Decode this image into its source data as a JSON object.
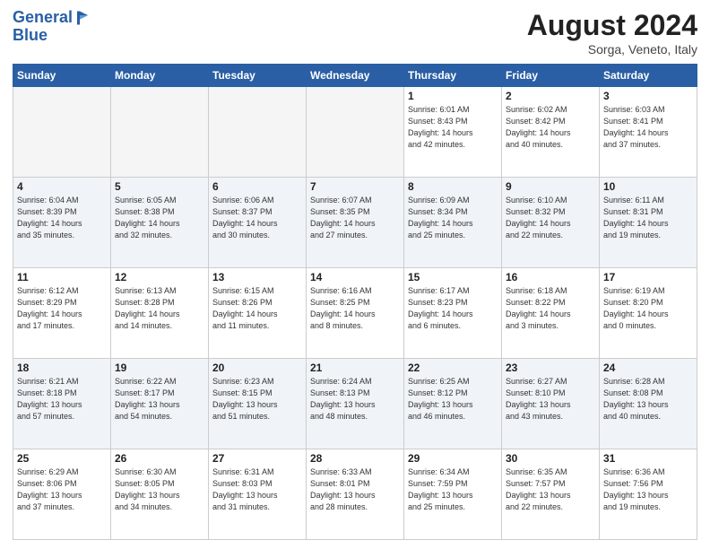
{
  "header": {
    "logo_line1": "General",
    "logo_line2": "Blue",
    "month": "August 2024",
    "location": "Sorga, Veneto, Italy"
  },
  "weekdays": [
    "Sunday",
    "Monday",
    "Tuesday",
    "Wednesday",
    "Thursday",
    "Friday",
    "Saturday"
  ],
  "weeks": [
    [
      {
        "day": "",
        "info": ""
      },
      {
        "day": "",
        "info": ""
      },
      {
        "day": "",
        "info": ""
      },
      {
        "day": "",
        "info": ""
      },
      {
        "day": "1",
        "info": "Sunrise: 6:01 AM\nSunset: 8:43 PM\nDaylight: 14 hours\nand 42 minutes."
      },
      {
        "day": "2",
        "info": "Sunrise: 6:02 AM\nSunset: 8:42 PM\nDaylight: 14 hours\nand 40 minutes."
      },
      {
        "day": "3",
        "info": "Sunrise: 6:03 AM\nSunset: 8:41 PM\nDaylight: 14 hours\nand 37 minutes."
      }
    ],
    [
      {
        "day": "4",
        "info": "Sunrise: 6:04 AM\nSunset: 8:39 PM\nDaylight: 14 hours\nand 35 minutes."
      },
      {
        "day": "5",
        "info": "Sunrise: 6:05 AM\nSunset: 8:38 PM\nDaylight: 14 hours\nand 32 minutes."
      },
      {
        "day": "6",
        "info": "Sunrise: 6:06 AM\nSunset: 8:37 PM\nDaylight: 14 hours\nand 30 minutes."
      },
      {
        "day": "7",
        "info": "Sunrise: 6:07 AM\nSunset: 8:35 PM\nDaylight: 14 hours\nand 27 minutes."
      },
      {
        "day": "8",
        "info": "Sunrise: 6:09 AM\nSunset: 8:34 PM\nDaylight: 14 hours\nand 25 minutes."
      },
      {
        "day": "9",
        "info": "Sunrise: 6:10 AM\nSunset: 8:32 PM\nDaylight: 14 hours\nand 22 minutes."
      },
      {
        "day": "10",
        "info": "Sunrise: 6:11 AM\nSunset: 8:31 PM\nDaylight: 14 hours\nand 19 minutes."
      }
    ],
    [
      {
        "day": "11",
        "info": "Sunrise: 6:12 AM\nSunset: 8:29 PM\nDaylight: 14 hours\nand 17 minutes."
      },
      {
        "day": "12",
        "info": "Sunrise: 6:13 AM\nSunset: 8:28 PM\nDaylight: 14 hours\nand 14 minutes."
      },
      {
        "day": "13",
        "info": "Sunrise: 6:15 AM\nSunset: 8:26 PM\nDaylight: 14 hours\nand 11 minutes."
      },
      {
        "day": "14",
        "info": "Sunrise: 6:16 AM\nSunset: 8:25 PM\nDaylight: 14 hours\nand 8 minutes."
      },
      {
        "day": "15",
        "info": "Sunrise: 6:17 AM\nSunset: 8:23 PM\nDaylight: 14 hours\nand 6 minutes."
      },
      {
        "day": "16",
        "info": "Sunrise: 6:18 AM\nSunset: 8:22 PM\nDaylight: 14 hours\nand 3 minutes."
      },
      {
        "day": "17",
        "info": "Sunrise: 6:19 AM\nSunset: 8:20 PM\nDaylight: 14 hours\nand 0 minutes."
      }
    ],
    [
      {
        "day": "18",
        "info": "Sunrise: 6:21 AM\nSunset: 8:18 PM\nDaylight: 13 hours\nand 57 minutes."
      },
      {
        "day": "19",
        "info": "Sunrise: 6:22 AM\nSunset: 8:17 PM\nDaylight: 13 hours\nand 54 minutes."
      },
      {
        "day": "20",
        "info": "Sunrise: 6:23 AM\nSunset: 8:15 PM\nDaylight: 13 hours\nand 51 minutes."
      },
      {
        "day": "21",
        "info": "Sunrise: 6:24 AM\nSunset: 8:13 PM\nDaylight: 13 hours\nand 48 minutes."
      },
      {
        "day": "22",
        "info": "Sunrise: 6:25 AM\nSunset: 8:12 PM\nDaylight: 13 hours\nand 46 minutes."
      },
      {
        "day": "23",
        "info": "Sunrise: 6:27 AM\nSunset: 8:10 PM\nDaylight: 13 hours\nand 43 minutes."
      },
      {
        "day": "24",
        "info": "Sunrise: 6:28 AM\nSunset: 8:08 PM\nDaylight: 13 hours\nand 40 minutes."
      }
    ],
    [
      {
        "day": "25",
        "info": "Sunrise: 6:29 AM\nSunset: 8:06 PM\nDaylight: 13 hours\nand 37 minutes."
      },
      {
        "day": "26",
        "info": "Sunrise: 6:30 AM\nSunset: 8:05 PM\nDaylight: 13 hours\nand 34 minutes."
      },
      {
        "day": "27",
        "info": "Sunrise: 6:31 AM\nSunset: 8:03 PM\nDaylight: 13 hours\nand 31 minutes."
      },
      {
        "day": "28",
        "info": "Sunrise: 6:33 AM\nSunset: 8:01 PM\nDaylight: 13 hours\nand 28 minutes."
      },
      {
        "day": "29",
        "info": "Sunrise: 6:34 AM\nSunset: 7:59 PM\nDaylight: 13 hours\nand 25 minutes."
      },
      {
        "day": "30",
        "info": "Sunrise: 6:35 AM\nSunset: 7:57 PM\nDaylight: 13 hours\nand 22 minutes."
      },
      {
        "day": "31",
        "info": "Sunrise: 6:36 AM\nSunset: 7:56 PM\nDaylight: 13 hours\nand 19 minutes."
      }
    ]
  ]
}
